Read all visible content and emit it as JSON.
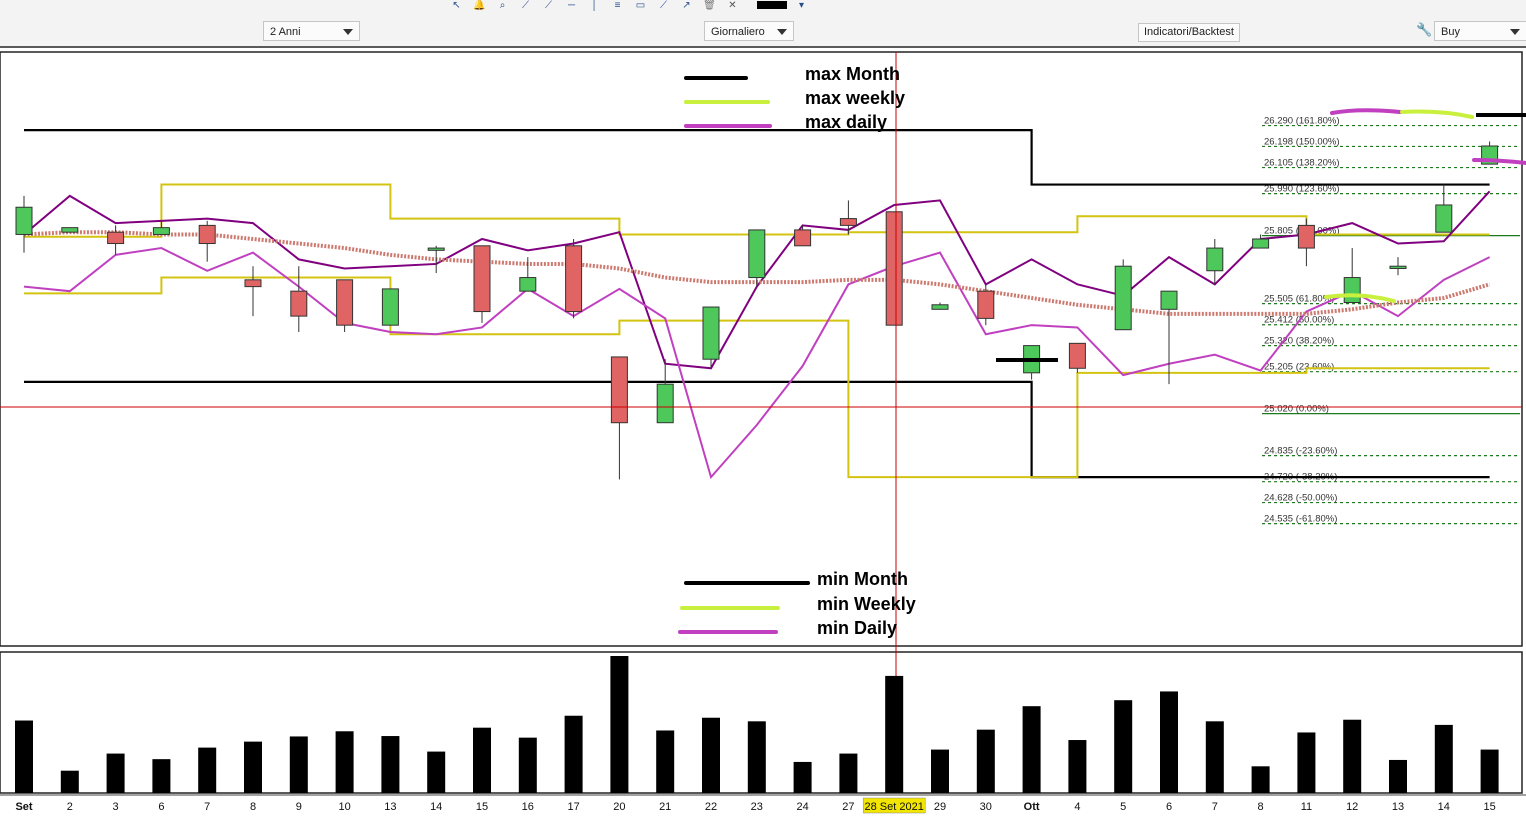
{
  "toolbar": {
    "icons": [
      "cursor-icon",
      "bell-icon",
      "zoom-icon",
      "line-icon",
      "trendline-icon",
      "horizontal-line-icon",
      "vertical-line-icon",
      "fibonacci-icon",
      "chart-icon",
      "drawing-tool-icon",
      "arrow-icon",
      "trash-icon",
      "settings-icon",
      "color-swatch"
    ],
    "period": "2 Anni",
    "interval": "Giornaliero",
    "indicators": "Indicatori/Backtest",
    "order": "Buy"
  },
  "annotations": {
    "max_month": "max Month",
    "max_weekly": "max weekly",
    "max_daily": "max daily",
    "min_month": "min Month",
    "min_weekly": "min Weekly",
    "min_daily": "min Daily"
  },
  "colors": {
    "up": "#4ec75b",
    "down": "#e06464",
    "max_month": "#000000",
    "weekly": "#d4c412",
    "weekly_note": "#c8f03c",
    "daily": "#800080",
    "daily_note": "#c040c0",
    "ma": "#cc7a70",
    "fib": "#1e7a1e",
    "cursor": "#cc0000"
  },
  "chart_data": {
    "type": "candlestick",
    "x_labels": [
      "Set",
      "2",
      "3",
      "6",
      "7",
      "8",
      "9",
      "10",
      "13",
      "14",
      "15",
      "16",
      "17",
      "20",
      "21",
      "22",
      "23",
      "24",
      "27",
      "28 Set 2021",
      "29",
      "30",
      "Ott",
      "4",
      "5",
      "6",
      "7",
      "8",
      "11",
      "12",
      "13",
      "14",
      "15"
    ],
    "highlight_label": "28 Set 2021",
    "ohlc": [
      [
        25.81,
        25.93,
        25.73,
        25.98
      ],
      [
        25.82,
        25.84,
        25.82,
        25.84
      ],
      [
        25.82,
        25.77,
        25.72,
        25.85
      ],
      [
        25.81,
        25.84,
        25.81,
        25.87
      ],
      [
        25.85,
        25.77,
        25.69,
        25.87
      ],
      [
        25.61,
        25.58,
        25.45,
        25.67
      ],
      [
        25.56,
        25.45,
        25.38,
        25.67
      ],
      [
        25.61,
        25.41,
        25.38,
        25.61
      ],
      [
        25.41,
        25.57,
        25.41,
        25.57
      ],
      [
        25.74,
        25.75,
        25.64,
        25.76
      ],
      [
        25.76,
        25.47,
        25.42,
        25.76
      ],
      [
        25.56,
        25.62,
        25.56,
        25.71
      ],
      [
        25.76,
        25.47,
        25.44,
        25.79
      ],
      [
        25.27,
        24.98,
        24.73,
        25.27
      ],
      [
        24.98,
        25.15,
        24.98,
        25.26
      ],
      [
        25.26,
        25.49,
        25.22,
        25.49
      ],
      [
        25.62,
        25.83,
        25.58,
        25.83
      ],
      [
        25.83,
        25.76,
        25.76,
        25.85
      ],
      [
        25.88,
        25.85,
        25.81,
        25.96
      ],
      [
        25.91,
        25.41,
        25.41,
        25.91
      ],
      [
        25.48,
        25.5,
        25.48,
        25.51
      ],
      [
        25.56,
        25.44,
        25.41,
        25.59
      ],
      [
        25.2,
        25.32,
        25.17,
        25.32
      ],
      [
        25.33,
        25.22,
        25.2,
        25.33
      ],
      [
        25.39,
        25.67,
        25.39,
        25.7
      ],
      [
        25.48,
        25.56,
        25.15,
        25.56
      ],
      [
        25.65,
        25.75,
        25.59,
        25.79
      ],
      [
        25.75,
        25.79,
        25.77,
        25.81
      ],
      [
        25.85,
        25.75,
        25.67,
        25.88
      ],
      [
        25.51,
        25.62,
        25.51,
        25.75
      ],
      [
        25.66,
        25.67,
        25.63,
        25.71
      ],
      [
        25.82,
        25.94,
        25.82,
        26.03
      ],
      [
        26.12,
        26.2,
        26.12,
        26.22
      ]
    ],
    "volume": [
      1.82,
      0.56,
      0.99,
      0.85,
      1.14,
      1.29,
      1.42,
      1.55,
      1.43,
      1.04,
      1.64,
      1.39,
      1.94,
      3.44,
      1.57,
      1.89,
      1.8,
      0.78,
      0.99,
      2.94,
      1.09,
      1.59,
      2.18,
      1.33,
      2.33,
      2.55,
      1.8,
      0.67,
      1.52,
      1.84,
      0.83,
      1.71,
      1.09
    ],
    "max_month": [
      26.27,
      26.27,
      26.27,
      26.27,
      26.27,
      26.27,
      26.27,
      26.27,
      26.27,
      26.27,
      26.27,
      26.27,
      26.27,
      26.27,
      26.27,
      26.27,
      26.27,
      26.27,
      26.27,
      26.27,
      26.27,
      26.27,
      26.03,
      26.03,
      26.03,
      26.03,
      26.03,
      26.03,
      26.03,
      26.03,
      26.03,
      26.03,
      26.03
    ],
    "min_month": [
      25.16,
      25.16,
      25.16,
      25.16,
      25.16,
      25.16,
      25.16,
      25.16,
      25.16,
      25.16,
      25.16,
      25.16,
      25.16,
      25.16,
      25.16,
      25.16,
      25.16,
      25.16,
      25.16,
      25.16,
      25.16,
      25.16,
      24.74,
      24.74,
      24.74,
      24.74,
      24.74,
      24.74,
      24.74,
      24.74,
      24.74,
      24.74,
      24.74
    ],
    "max_weekly": [
      25.8,
      25.8,
      25.8,
      26.03,
      26.03,
      26.03,
      26.03,
      26.03,
      25.88,
      25.88,
      25.88,
      25.88,
      25.88,
      25.81,
      25.81,
      25.81,
      25.81,
      25.81,
      25.82,
      25.82,
      25.82,
      25.82,
      25.82,
      25.89,
      25.89,
      25.89,
      25.89,
      25.89,
      25.81,
      25.81,
      25.81,
      25.81,
      25.81
    ],
    "min_weekly": [
      25.55,
      25.55,
      25.55,
      25.62,
      25.62,
      25.62,
      25.62,
      25.62,
      25.37,
      25.37,
      25.37,
      25.37,
      25.37,
      25.43,
      25.43,
      25.43,
      25.43,
      25.43,
      24.74,
      24.74,
      24.74,
      24.74,
      24.74,
      25.2,
      25.2,
      25.2,
      25.2,
      25.2,
      25.22,
      25.22,
      25.22,
      25.22,
      25.22
    ],
    "max_daily": [
      25.81,
      25.98,
      25.86,
      25.87,
      25.88,
      25.86,
      25.7,
      25.66,
      25.67,
      25.68,
      25.79,
      25.74,
      25.77,
      25.82,
      25.24,
      25.22,
      25.58,
      25.85,
      25.83,
      25.94,
      25.96,
      25.59,
      25.7,
      25.59,
      25.54,
      25.71,
      25.59,
      25.79,
      25.81,
      25.86,
      25.77,
      25.78,
      26.0
    ],
    "min_daily": [
      25.58,
      25.56,
      25.72,
      25.75,
      25.65,
      25.73,
      25.58,
      25.42,
      25.38,
      25.37,
      25.4,
      25.57,
      25.45,
      25.57,
      25.44,
      24.74,
      24.97,
      25.23,
      25.59,
      25.67,
      25.73,
      25.37,
      25.41,
      25.4,
      25.19,
      25.24,
      25.28,
      25.21,
      25.47,
      25.56,
      25.45,
      25.61,
      25.71
    ],
    "ma": [
      25.81,
      25.82,
      25.82,
      25.81,
      25.81,
      25.79,
      25.77,
      25.75,
      25.72,
      25.7,
      25.69,
      25.68,
      25.68,
      25.66,
      25.62,
      25.6,
      25.6,
      25.6,
      25.61,
      25.61,
      25.59,
      25.56,
      25.53,
      25.5,
      25.48,
      25.46,
      25.46,
      25.46,
      25.46,
      25.48,
      25.51,
      25.53,
      25.59
    ],
    "fib_levels": [
      {
        "price": 26.29,
        "label": "26.290 (161.80%)"
      },
      {
        "price": 26.198,
        "label": "26.198 (150.00%)"
      },
      {
        "price": 26.105,
        "label": "26.105 (138.20%)"
      },
      {
        "price": 25.99,
        "label": "25.990 (123.60%)"
      },
      {
        "price": 25.805,
        "label": "25.805 (100.00%)"
      },
      {
        "price": 25.505,
        "label": "25.505 (61.80%)"
      },
      {
        "price": 25.412,
        "label": "25.412 (50.00%)"
      },
      {
        "price": 25.32,
        "label": "25.320 (38.20%)"
      },
      {
        "price": 25.205,
        "label": "25.205 (23.60%)"
      },
      {
        "price": 25.02,
        "label": "25.020 (0.00%)"
      },
      {
        "price": 24.835,
        "label": "24.835 (-23.60%)"
      },
      {
        "price": 24.72,
        "label": "24.720 (-38.20%)"
      },
      {
        "price": 24.628,
        "label": "24.628 (-50.00%)"
      },
      {
        "price": 24.535,
        "label": "24.535 (-61.80%)"
      }
    ],
    "ylim": [
      24.0,
      26.61
    ]
  }
}
